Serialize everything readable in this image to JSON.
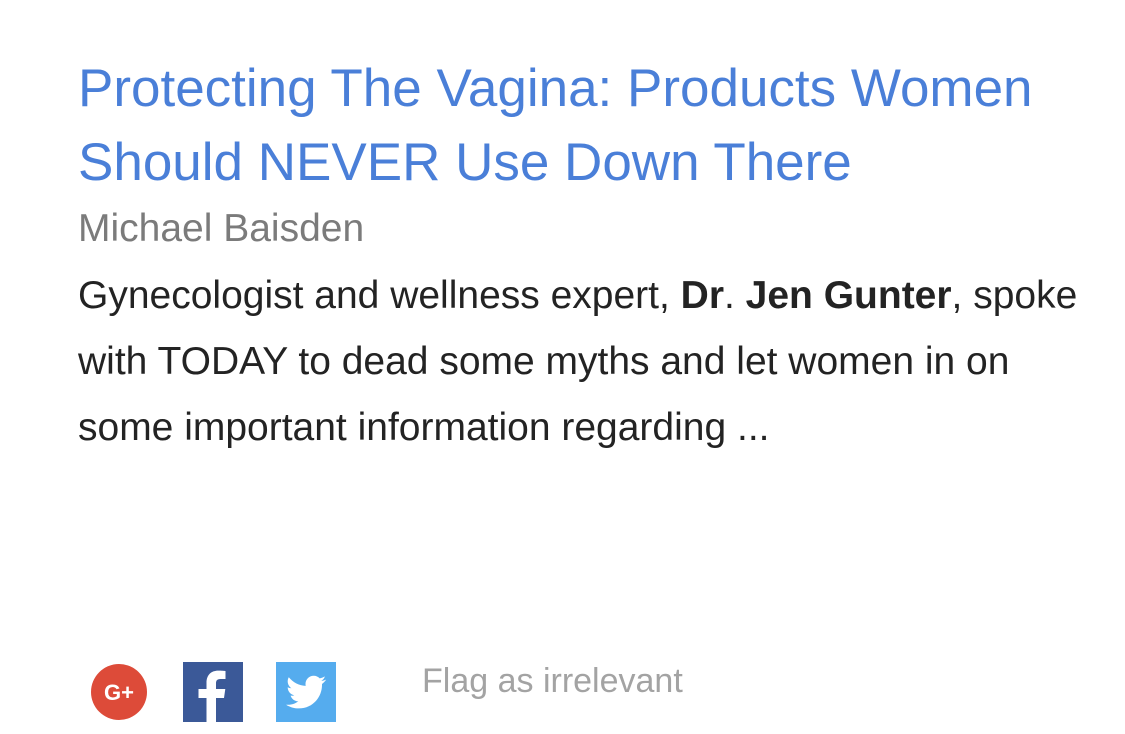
{
  "result": {
    "title": "Protecting The Vagina: Products Women Should NEVER Use Down There",
    "source": "Michael Baisden",
    "snippet": {
      "part1": "Gynecologist and wellness expert, ",
      "bold1": "Dr",
      "part2": ". ",
      "bold2": "Jen Gunter",
      "part3": ", spoke with TODAY to dead some myths and let women in on some important information regarding ..."
    }
  },
  "actions": {
    "gplus_icon": "google-plus-icon",
    "gplus_text": "G+",
    "facebook_icon": "facebook-icon",
    "twitter_icon": "twitter-icon",
    "flag_label": "Flag as irrelevant"
  },
  "colors": {
    "title": "#4a7fd8",
    "source": "#7b7b7b",
    "snippet": "#232323",
    "gplus": "#dd4b39",
    "facebook": "#3b5998",
    "twitter": "#55acee",
    "flag": "#a3a3a3"
  }
}
